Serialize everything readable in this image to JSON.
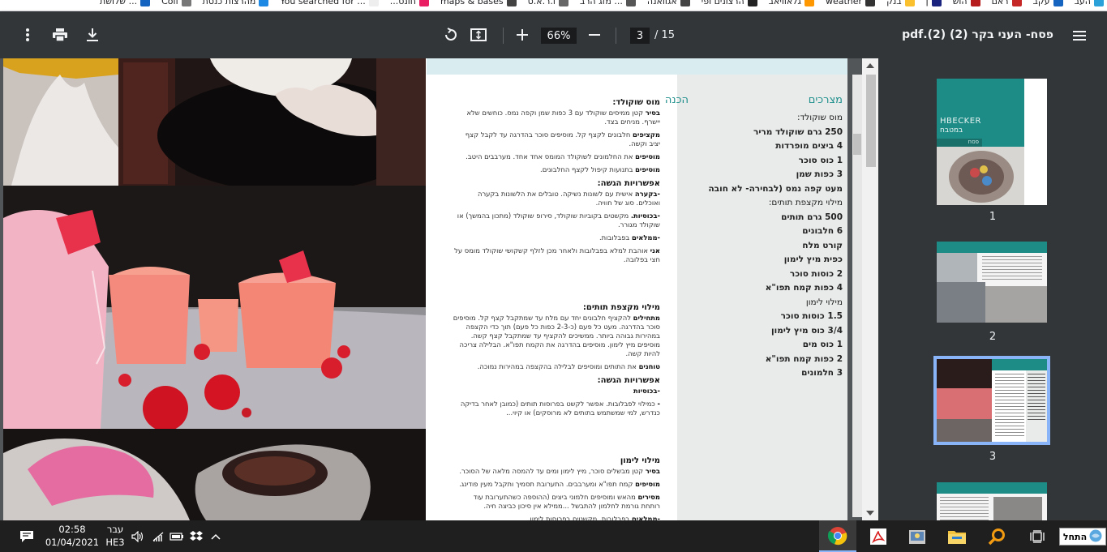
{
  "bookmarks": [
    {
      "label": "העב",
      "color": "#2aa1d8"
    },
    {
      "label": "עקב",
      "color": "#1565c0"
    },
    {
      "label": "ראם",
      "color": "#c62828"
    },
    {
      "label": "הוש",
      "color": "#b71c1c"
    },
    {
      "label": "ן",
      "color": "#1a237e"
    },
    {
      "label": "בנק",
      "color": "#fbc02d"
    },
    {
      "label": "weather",
      "color": "#333333"
    },
    {
      "label": "גלאוויאב",
      "color": "#ff9800"
    },
    {
      "label": "הרצונים ופי",
      "color": "#222222"
    },
    {
      "label": "אגוואנה",
      "color": "#444444"
    },
    {
      "label": "מזג הרב ...",
      "color": "#555555"
    },
    {
      "label": "ו.ר.א.ס",
      "color": "#666666"
    },
    {
      "label": "maps & bases",
      "color": "#424242"
    },
    {
      "label": "...חונט",
      "color": "#e91e63"
    },
    {
      "label": "You searched for ...",
      "color": "#eeeeee"
    },
    {
      "label": "מהרצות כנסת",
      "color": "#1e88e5"
    },
    {
      "label": "Coll",
      "color": "#777777"
    },
    {
      "label": "שלושת ...",
      "color": "#1565c0"
    }
  ],
  "toolbar": {
    "title": "פסח- העני בקר (2) (2).pdf",
    "page_current": "3",
    "page_total": "/ 15",
    "zoom": "66%",
    "icons": [
      "menu-icon",
      "rotate-icon",
      "fit-page-icon",
      "zoom-in-icon",
      "zoom-out-icon",
      "download-icon",
      "print-icon",
      "more-icon"
    ]
  },
  "doc": {
    "ingredients_heading": "מצרכים",
    "prep_heading": "הכנה",
    "ingredients": [
      {
        "text": "מוס שוקולד:",
        "bold": false
      },
      {
        "text": "250 גרם שוקולד מריר",
        "bold": true
      },
      {
        "text": "4 ביצים מופרדות",
        "bold": true
      },
      {
        "text": "1 כוס סוכר",
        "bold": true
      },
      {
        "text": "3 כפות שמן",
        "bold": true
      },
      {
        "text": "מעט קפה נמס (לבחירה- לא חובה",
        "bold": true
      },
      {
        "text": "מילוי מקצפת תותים:",
        "bold": false
      },
      {
        "text": "500 גרם תותים",
        "bold": true
      },
      {
        "text": "6 חלבונים",
        "bold": true
      },
      {
        "text": "קורט מלח",
        "bold": true
      },
      {
        "text": "כפית מיץ לימון",
        "bold": true
      },
      {
        "text": "2 כוסות סוכר",
        "bold": true
      },
      {
        "text": "4 כפות קמח תפו\"א",
        "bold": true
      },
      {
        "text": "מילוי לימון",
        "bold": false
      },
      {
        "text": "1.5 כוסות סוכר",
        "bold": true
      },
      {
        "text": "3/4 כוס מיץ לימון",
        "bold": true
      },
      {
        "text": "1 כוס מים",
        "bold": true
      },
      {
        "text": "2 כפות קמח תפו\"א",
        "bold": true
      },
      {
        "text": "3 חלמונים",
        "bold": true
      }
    ],
    "prep": [
      {
        "type": "h",
        "text": "מוס שוקולד:"
      },
      {
        "type": "t",
        "lead": "בסיר",
        "text": " קטן ממיסים שוקולד עם 3 כפות שמן וקפה נמס. כוחשים שלא יישרף. מניחים בצד."
      },
      {
        "type": "t",
        "lead": "מקציפים",
        "text": " חלבונים לקצף קל. מוסיפים סוכר בהדרגה עד לקבל קצף יציב וקשה."
      },
      {
        "type": "t",
        "lead": "מוסיפים",
        "text": " את החלמונים לשוקולד המומס אחד אחד. מערבבים היטב."
      },
      {
        "type": "t",
        "lead": "מוסיפים",
        "text": " בתנועות קיפול לקצף החלבונים."
      },
      {
        "type": "h",
        "text": "אפשרויות הגשה:"
      },
      {
        "type": "t",
        "lead": "-בקערה",
        "text": " אישית עם לשונות נשיקה. טובלים את הלשונות בקערה ואוכלים. סוג של חוויה."
      },
      {
        "type": "t",
        "lead": "-בכוסיות.",
        "text": " מקשטים בקוביות שוקולד, סירופ שוקולד (מתכון בהמשך) או שוקולד מגורר."
      },
      {
        "type": "t",
        "lead": "-ממלאים",
        "text": " בפבלובות."
      },
      {
        "type": "t",
        "lead": "אני",
        "text": " אוהבת למלא בפבלובות ולאחר מכן לזלף קשקושי שוקולד מומס על חצי בפלובה."
      },
      {
        "type": "gap"
      },
      {
        "type": "h",
        "text": "מילוי מקצפת תותים:"
      },
      {
        "type": "t",
        "lead": "מתחילים",
        "text": " להקציף חלבונים יחד עם מלח עד שמתקבל קצף קל. מוסיפים סוכר בהדרגה. מעט כל פעם (כ-2-3 כפות כל פעם) תוך כדי הקצפה במהירות גבוהה ביותר. ממשיכים להקציף עד שמתקבל קצף קשה. מוסיפים מיץ לימון. מוסיפים בהדרגה את הקמח תפו\"א. הבלילה צריכה להיות קשה."
      },
      {
        "type": "t",
        "lead": "טוחנים",
        "text": " את התותים ומוסיפים לבלילה בהקצפה במהירות נמוכה."
      },
      {
        "type": "h",
        "text": "אפשרויות הגשה:"
      },
      {
        "type": "t",
        "lead": "-בכוסיות",
        "text": ""
      },
      {
        "type": "t",
        "lead": "-",
        "text": " כמילוי לפבלובות. אפשר לקשט בפרוסות תותים (כמובן לאחר בדיקה כנדרש, למי שמשתמש בתותים לא מרוסקים) או קיוי..."
      },
      {
        "type": "gap"
      },
      {
        "type": "h",
        "text": "מילוי לימון"
      },
      {
        "type": "t",
        "lead": "בסיר",
        "text": " קטן מבשלים סוכר, מיץ לימון ומים עד להמסה מלאה של הסוכר."
      },
      {
        "type": "t",
        "lead": "מוסיפים",
        "text": " קמח תפו\"א ומערבבים. התערובת תסמיך ותקבל מעין פודינג."
      },
      {
        "type": "t",
        "lead": "מסירים",
        "text": " מהאש ומוסיפים חלמוני ביצים (ההוספה כשהתערובת עוד רותחת גורמת לחלמון להתבשל ...ממילא אין סיכון כביצה חיה."
      },
      {
        "type": "t",
        "lead": "-ממלאים",
        "text": " בפבלובות. מקשטים בפרוסות לימון."
      }
    ]
  },
  "thumbnails": [
    {
      "label": "1",
      "brand": "HBECKER",
      "sub": "במטבח",
      "tag": "פסח"
    },
    {
      "label": "2"
    },
    {
      "label": "3"
    },
    {
      "label": ""
    }
  ],
  "taskbar": {
    "time": "02:58",
    "date": "01/04/2021",
    "lang_top": "עבר",
    "lang_bottom": "HE3",
    "start_label": "התחל"
  }
}
